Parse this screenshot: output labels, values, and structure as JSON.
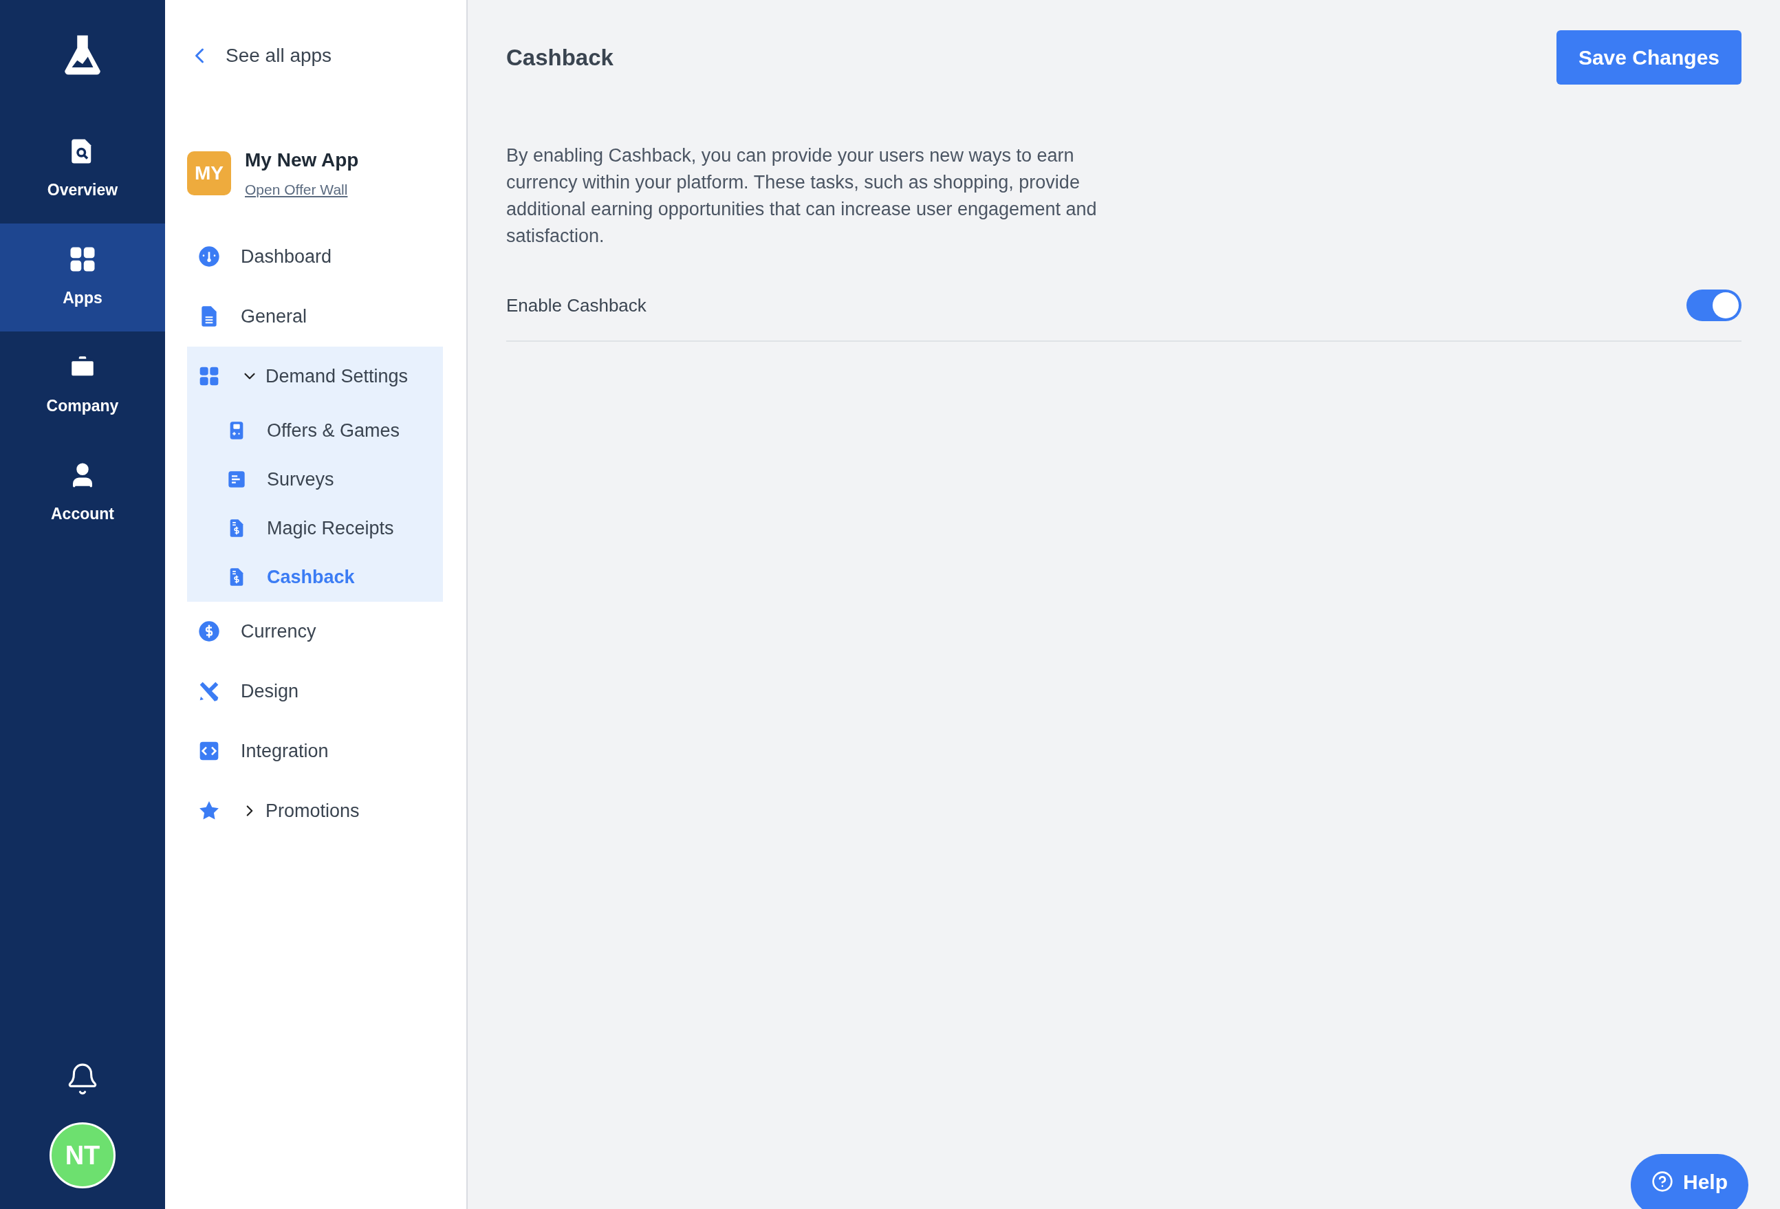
{
  "rail": {
    "items": [
      {
        "label": "Overview",
        "kind": "doc-search",
        "selected": false
      },
      {
        "label": "Apps",
        "kind": "grid",
        "selected": true
      },
      {
        "label": "Company",
        "kind": "briefcase",
        "selected": false
      },
      {
        "label": "Account",
        "kind": "person",
        "selected": false
      }
    ],
    "avatar": "NT"
  },
  "sidebar": {
    "back": "See all apps",
    "app": {
      "badge": "MY",
      "name": "My New App",
      "link": "Open Offer Wall"
    },
    "items": [
      {
        "label": "Dashboard",
        "kind": "gauge",
        "selected": false
      },
      {
        "label": "General",
        "kind": "doc",
        "selected": false
      },
      {
        "label": "Demand Settings",
        "kind": "grid",
        "selected": false,
        "expanded": true,
        "children": [
          {
            "label": "Offers & Games",
            "kind": "gameboy",
            "selected": false
          },
          {
            "label": "Surveys",
            "kind": "survey",
            "selected": false
          },
          {
            "label": "Magic Receipts",
            "kind": "receipt",
            "selected": false
          },
          {
            "label": "Cashback",
            "kind": "receipt",
            "selected": true
          }
        ]
      },
      {
        "label": "Currency",
        "kind": "dollar",
        "selected": false
      },
      {
        "label": "Design",
        "kind": "design",
        "selected": false
      },
      {
        "label": "Integration",
        "kind": "code",
        "selected": false
      },
      {
        "label": "Promotions",
        "kind": "star",
        "selected": false,
        "expanded": false
      }
    ]
  },
  "main": {
    "title": "Cashback",
    "save_button": "Save Changes",
    "description": "By enabling Cashback, you can provide your users new ways to earn currency within your platform. These tasks, such as shopping, provide additional earning opportunities that can increase user engagement and satisfaction.",
    "setting": {
      "label": "Enable Cashback",
      "on": true
    },
    "help_button": "Help"
  }
}
